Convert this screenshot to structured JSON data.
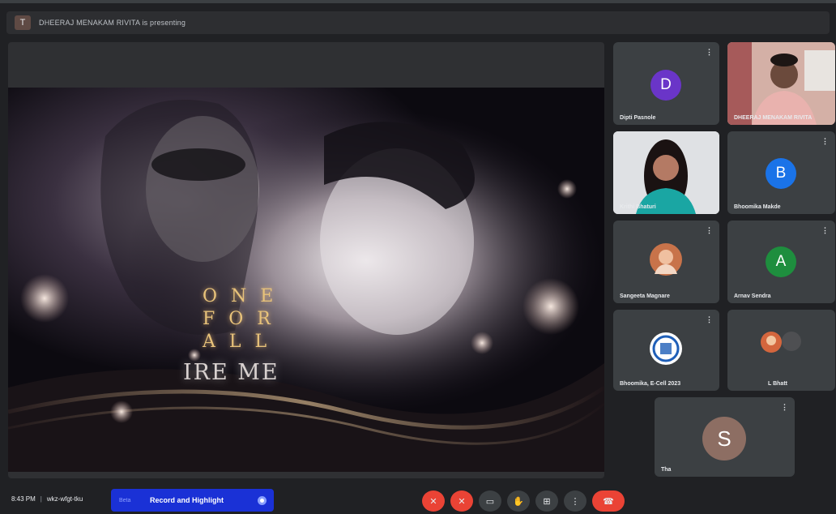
{
  "presenting_bar": {
    "text": "DHEERAJ MENAKAM RIVITA is presenting"
  },
  "shared_screen": {
    "poster_lines": [
      "ONE",
      "FOR",
      "ALL"
    ],
    "poster_title": "IRE ME"
  },
  "participants": [
    {
      "name": "Dipti Pasnole",
      "initial": "D",
      "color": "#6a35c8",
      "mic": "⋮"
    },
    {
      "name": "DHEERAJ MENAKAM RIVITA",
      "initial": "",
      "color": "",
      "mic": ""
    },
    {
      "name": "Krithi Bhaturi",
      "initial": "",
      "color": "",
      "mic": ""
    },
    {
      "name": "Bhoomika Makde",
      "initial": "B",
      "color": "#1a73e8",
      "mic": "⋮"
    },
    {
      "name": "Sangeeta Magnare",
      "initial": "",
      "color": "",
      "mic": "⋮"
    },
    {
      "name": "Arnav Sendra",
      "initial": "A",
      "color": "#1e8e3e",
      "mic": "⋮"
    },
    {
      "name": "Bhoomika, E-Cell 2023",
      "initial": "",
      "color": "",
      "mic": "⋮"
    },
    {
      "name": "L Bhatt",
      "initial": "",
      "color": "",
      "mic": ""
    },
    {
      "name": "Tha",
      "initial": "S",
      "color": "#8d6e63",
      "mic": "⋮"
    }
  ],
  "bottom_bar": {
    "time": "8:43 PM",
    "meeting_code": "wkz-wfgt-tku",
    "record_prefix": "Beta",
    "record_label": "Record and Highlight"
  },
  "controls": [
    {
      "icon": "mic-off-icon",
      "glyph": "✕"
    },
    {
      "icon": "camera-off-icon",
      "glyph": "✕"
    },
    {
      "icon": "captions-icon",
      "glyph": "▭"
    },
    {
      "icon": "raise-hand-icon",
      "glyph": "✋"
    },
    {
      "icon": "present-icon",
      "glyph": "⊞"
    },
    {
      "icon": "more-options-icon",
      "glyph": "⋮"
    },
    {
      "icon": "end-call-icon",
      "glyph": "☎"
    }
  ]
}
